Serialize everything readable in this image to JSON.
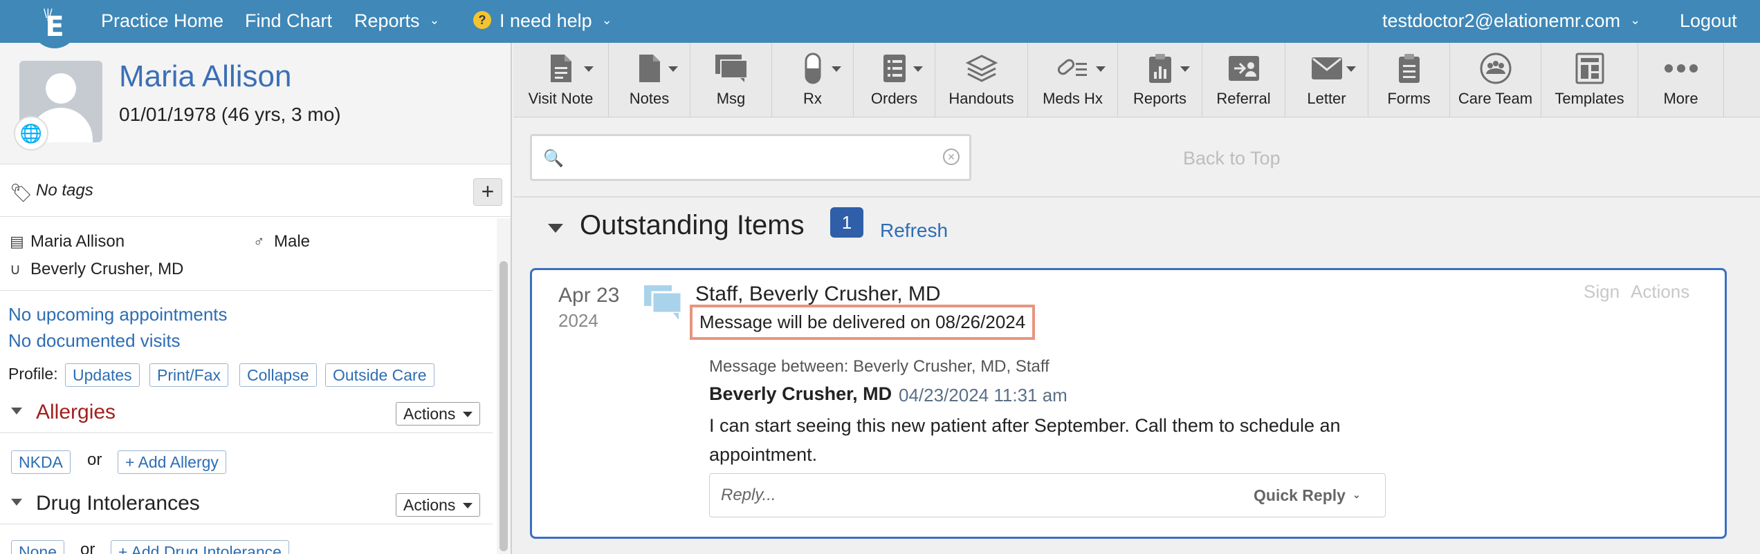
{
  "nav": {
    "practice_home": "Practice Home",
    "find_chart": "Find Chart",
    "reports": "Reports",
    "help": "I need help",
    "user_email": "testdoctor2@elationemr.com",
    "logout": "Logout"
  },
  "patient": {
    "name": "Maria Allison",
    "dob": "01/01/1978 (46 yrs, 3 mo)",
    "tags": "No tags",
    "display_name": "Maria Allison",
    "sex": "Male",
    "provider": "Beverly Crusher, MD",
    "upcoming": "No upcoming appointments",
    "visits": "No documented visits",
    "profile_label": "Profile:",
    "profile_buttons": [
      "Updates",
      "Print/Fax",
      "Collapse",
      "Outside Care"
    ]
  },
  "allergies": {
    "title": "Allergies",
    "actions": "Actions",
    "nkda": "NKDA",
    "or": "or",
    "add": "+ Add Allergy"
  },
  "intolerances": {
    "title": "Drug Intolerances",
    "actions": "Actions",
    "none": "None",
    "or": "or",
    "add": "+ Add Drug Intolerance"
  },
  "toolbar": {
    "items": [
      "Visit Note",
      "Notes",
      "Msg",
      "Rx",
      "Orders",
      "Handouts",
      "Meds Hx",
      "Reports",
      "Referral",
      "Letter",
      "Forms",
      "Care Team",
      "Templates",
      "More"
    ]
  },
  "main": {
    "search_placeholder": "",
    "back_to_top": "Back to Top",
    "outstanding_title": "Outstanding Items",
    "outstanding_count": "1",
    "refresh": "Refresh"
  },
  "item": {
    "date": "Apr 23",
    "year": "2024",
    "from": "Staff, Beverly Crusher, MD",
    "delivery": "Message will be delivered on 08/26/2024",
    "sign": "Sign",
    "actions": "Actions",
    "between": "Message between: Beverly Crusher, MD, Staff",
    "author": "Beverly Crusher, MD",
    "timestamp": "04/23/2024 11:31 am",
    "body": "I can start seeing this new patient after September. Call them to schedule an appointment.",
    "reply_placeholder": "Reply...",
    "quick_reply": "Quick Reply"
  },
  "colors": {
    "nav_bg": "#3f88b8",
    "link": "#2d6db4",
    "allergy_red": "#a3201f",
    "card_border": "#3a6fbf",
    "highlight": "#e8957e"
  }
}
